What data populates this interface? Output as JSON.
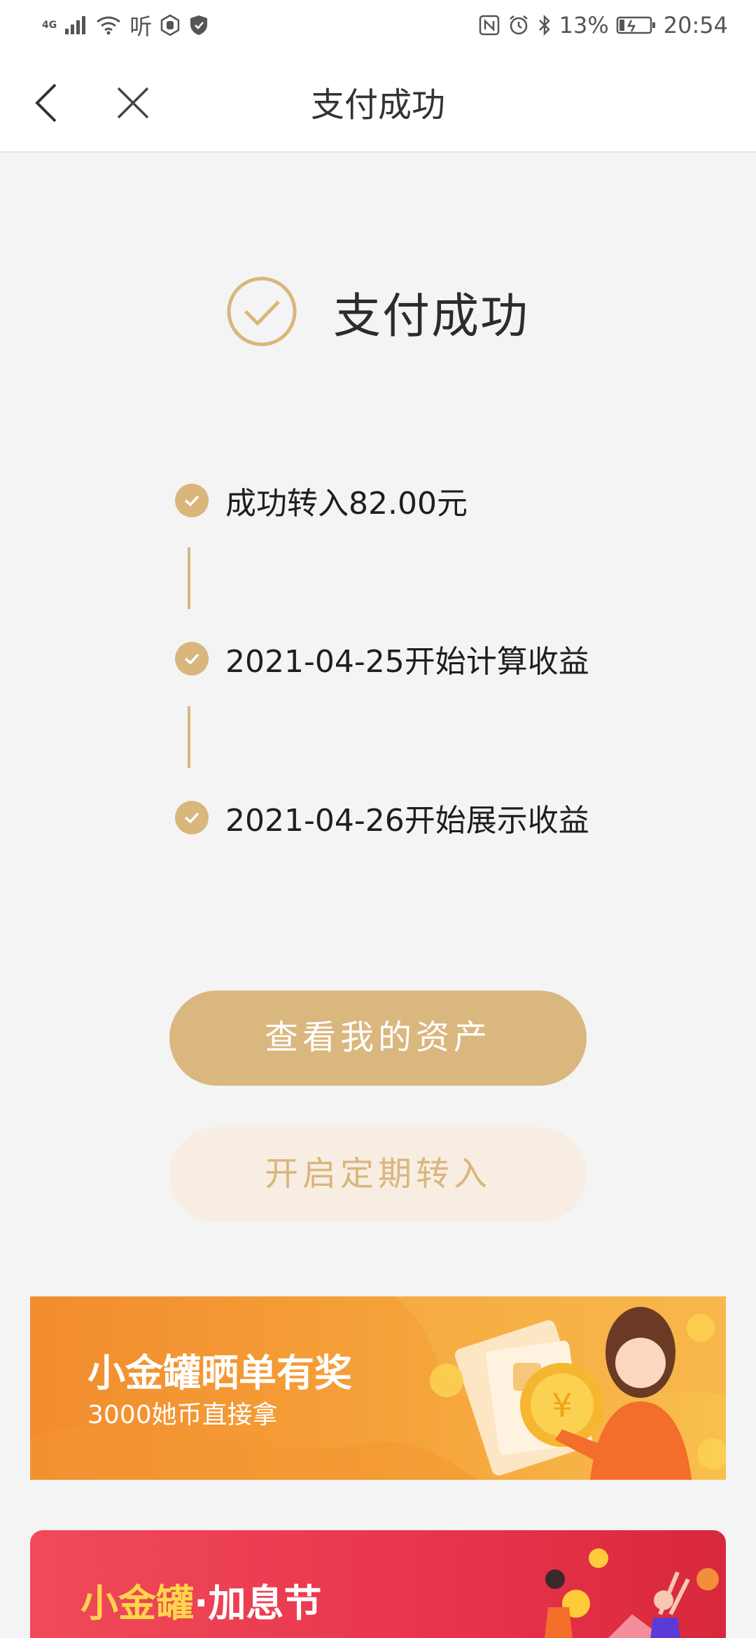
{
  "status_bar": {
    "network": "4G",
    "listen_label": "听",
    "battery_percent": "13%",
    "time": "20:54"
  },
  "nav": {
    "title": "支付成功"
  },
  "result": {
    "title": "支付成功"
  },
  "steps": [
    {
      "text": "成功转入82.00元"
    },
    {
      "text": "2021-04-25开始计算收益"
    },
    {
      "text": "2021-04-26开始展示收益"
    }
  ],
  "buttons": {
    "primary": "查看我的资产",
    "secondary": "开启定期转入"
  },
  "banner1": {
    "title": "小金罐晒单有奖",
    "subtitle": "3000她币直接拿"
  },
  "banner2": {
    "title_a": "小金罐",
    "sep": "·",
    "title_b": "加息节"
  },
  "colors": {
    "accent": "#d9b67c",
    "primary_button": "#dab77e",
    "secondary_button_bg": "#f8ede2",
    "banner1": "#f5a33a",
    "banner2": "#e8344b"
  }
}
